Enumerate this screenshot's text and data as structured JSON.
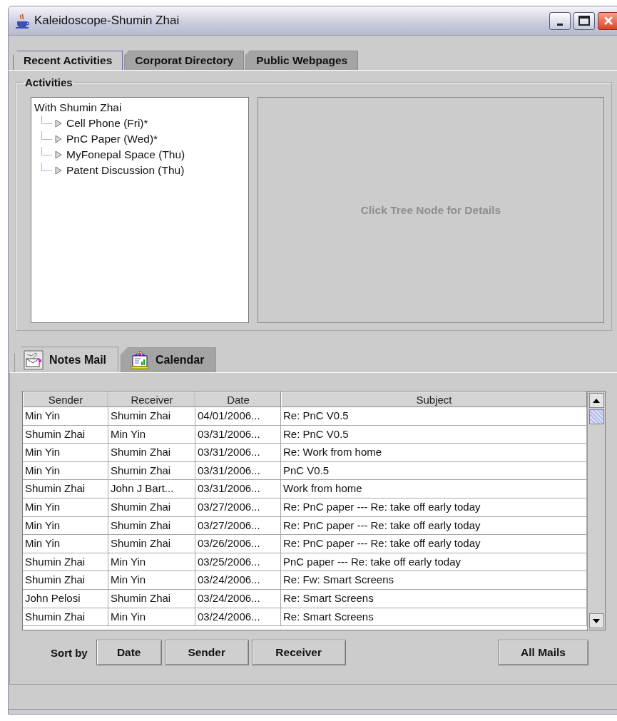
{
  "window": {
    "title": "Kaleidoscope-Shumin Zhai"
  },
  "tabs": [
    {
      "label": "Recent Activities",
      "selected": true
    },
    {
      "label": "Corporat Directory",
      "selected": false
    },
    {
      "label": "Public Webpages",
      "selected": false
    }
  ],
  "activities": {
    "title": "Activities",
    "tree": {
      "label": "With Shumin Zhai",
      "children": [
        {
          "label": "Cell Phone (Fri)*",
          "expanded": false
        },
        {
          "label": "PnC Paper (Wed)*",
          "expanded": false
        },
        {
          "label": "MyFonepal Space (Thu)",
          "expanded": false
        },
        {
          "label": "Patent Discussion (Thu)",
          "expanded": false
        }
      ]
    },
    "detail_hint": "Click Tree Node for Details"
  },
  "mail_tabs": [
    {
      "label": "Notes Mail",
      "kind": "mail",
      "selected": true
    },
    {
      "label": "Calendar",
      "kind": "calendar",
      "selected": false
    }
  ],
  "table": {
    "columns": [
      "Sender",
      "Receiver",
      "Date",
      "Subject"
    ],
    "rows": [
      [
        "Min Yin",
        "Shumin Zhai",
        "04/01/2006...",
        "Re: PnC V0.5"
      ],
      [
        "Shumin Zhai",
        "Min Yin",
        "03/31/2006...",
        "Re: PnC V0.5"
      ],
      [
        "Min Yin",
        "Shumin Zhai",
        "03/31/2006...",
        "Re: Work from home"
      ],
      [
        "Min Yin",
        "Shumin Zhai",
        "03/31/2006...",
        "PnC V0.5"
      ],
      [
        "Shumin Zhai",
        "John J Bart...",
        "03/31/2006...",
        "Work from home"
      ],
      [
        "Min Yin",
        "Shumin Zhai",
        "03/27/2006...",
        "Re: PnC paper --- Re: take off early today"
      ],
      [
        "Min Yin",
        "Shumin Zhai",
        "03/27/2006...",
        "Re: PnC paper --- Re: take off early today"
      ],
      [
        "Min Yin",
        "Shumin Zhai",
        "03/26/2006...",
        "Re: PnC paper --- Re: take off early today"
      ],
      [
        "Shumin Zhai",
        "Min Yin",
        "03/25/2006...",
        "PnC paper --- Re: take off early today"
      ],
      [
        "Shumin Zhai",
        "Min Yin",
        "03/24/2006...",
        "Re: Fw: Smart Screens"
      ],
      [
        "John Pelosi",
        "Shumin Zhai",
        "03/24/2006...",
        "Re: Smart Screens"
      ],
      [
        "Shumin Zhai",
        "Min Yin",
        "03/24/2006...",
        "Re: Smart Screens"
      ]
    ]
  },
  "sort_label": "Sort by",
  "sort_buttons": [
    "Date",
    "Sender",
    "Receiver"
  ],
  "all_mails_button": "All Mails"
}
